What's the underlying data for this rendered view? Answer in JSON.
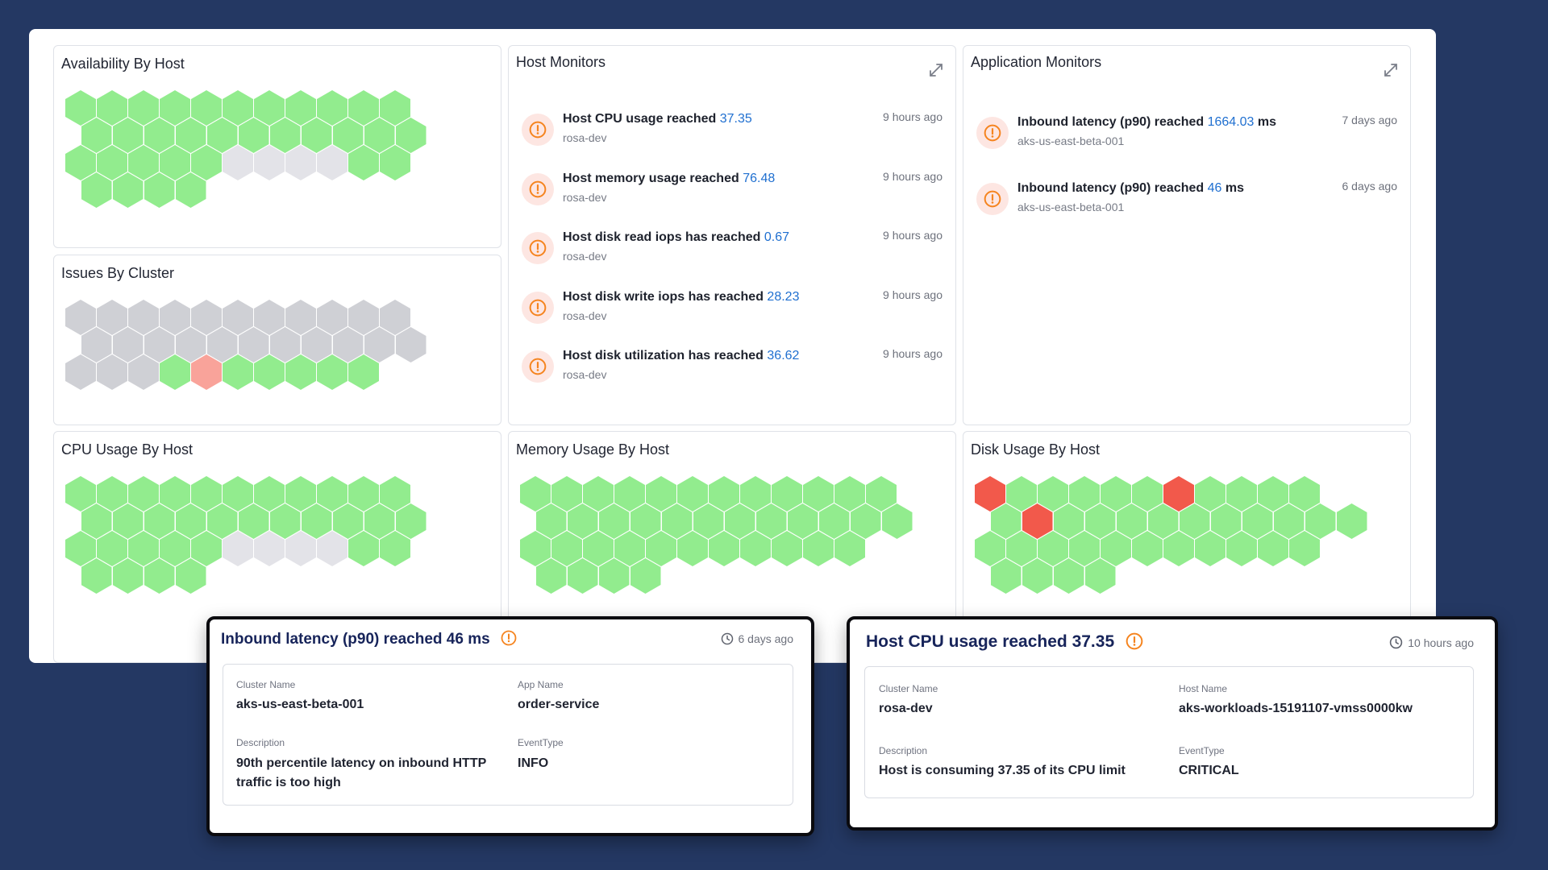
{
  "panels": {
    "availability": {
      "title": "Availability By Host"
    },
    "issues": {
      "title": "Issues By Cluster"
    },
    "cpu": {
      "title": "CPU Usage By Host"
    },
    "memory": {
      "title": "Memory Usage By Host"
    },
    "disk": {
      "title": "Disk Usage By Host"
    },
    "host_monitors": {
      "title": "Host Monitors",
      "items": [
        {
          "text": "Host CPU usage reached",
          "value": "37.35",
          "suffix": "",
          "source": "rosa-dev",
          "time": "9 hours ago"
        },
        {
          "text": "Host memory usage reached",
          "value": "76.48",
          "suffix": "",
          "source": "rosa-dev",
          "time": "9 hours ago"
        },
        {
          "text": "Host disk read iops has reached",
          "value": "0.67",
          "suffix": "",
          "source": "rosa-dev",
          "time": "9 hours ago"
        },
        {
          "text": "Host disk write iops has reached",
          "value": "28.23",
          "suffix": "",
          "source": "rosa-dev",
          "time": "9 hours ago"
        },
        {
          "text": "Host disk utilization has reached",
          "value": "36.62",
          "suffix": "",
          "source": "rosa-dev",
          "time": "9 hours ago"
        }
      ]
    },
    "app_monitors": {
      "title": "Application Monitors",
      "items": [
        {
          "text": "Inbound latency (p90) reached",
          "value": "1664.03",
          "suffix": "ms",
          "source": "aks-us-east-beta-001",
          "time": "7 days ago"
        },
        {
          "text": "Inbound latency (p90) reached",
          "value": "46",
          "suffix": "ms",
          "source": "aks-us-east-beta-001",
          "time": "6 days ago"
        }
      ]
    }
  },
  "hex_states": {
    "availability": [
      "g",
      "g",
      "g",
      "g",
      "g",
      "g",
      "g",
      "g",
      "g",
      "g",
      "g",
      "g",
      "g",
      "g",
      "g",
      "g",
      "g",
      "g",
      "g",
      "g",
      "g",
      "g",
      "g",
      "g",
      "g",
      "g",
      "g",
      "l",
      "l",
      "l",
      "l",
      "g",
      "g",
      "g",
      "g",
      "g",
      "g"
    ],
    "issues": [
      "a",
      "a",
      "a",
      "a",
      "a",
      "a",
      "a",
      "a",
      "a",
      "a",
      "a",
      "a",
      "a",
      "a",
      "a",
      "a",
      "a",
      "a",
      "a",
      "a",
      "a",
      "a",
      "a",
      "a",
      "a",
      "g",
      "s",
      "g",
      "g",
      "g",
      "g",
      "g"
    ],
    "cpu": [
      "g",
      "g",
      "g",
      "g",
      "g",
      "g",
      "g",
      "g",
      "g",
      "g",
      "g",
      "g",
      "g",
      "g",
      "g",
      "g",
      "g",
      "g",
      "g",
      "g",
      "g",
      "g",
      "g",
      "g",
      "g",
      "g",
      "g",
      "l",
      "l",
      "l",
      "l",
      "g",
      "g",
      "g",
      "g",
      "g",
      "g"
    ],
    "memory": [
      "g",
      "g",
      "g",
      "g",
      "g",
      "g",
      "g",
      "g",
      "g",
      "g",
      "g",
      "g",
      "g",
      "g",
      "g",
      "g",
      "g",
      "g",
      "g",
      "g",
      "g",
      "g",
      "g",
      "g",
      "g",
      "g",
      "g",
      "g",
      "g",
      "g",
      "g",
      "g",
      "g",
      "g",
      "g",
      "g",
      "g",
      "g",
      "g"
    ],
    "disk": [
      "r",
      "g",
      "g",
      "g",
      "g",
      "g",
      "r",
      "g",
      "g",
      "g",
      "g",
      "g",
      "r",
      "g",
      "g",
      "g",
      "g",
      "g",
      "g",
      "g",
      "g",
      "g",
      "g",
      "g",
      "g",
      "g",
      "g",
      "g",
      "g",
      "g",
      "g",
      "g",
      "g",
      "g",
      "g",
      "g",
      "g",
      "g"
    ]
  },
  "popup_left": {
    "title": "Inbound latency (p90) reached 46 ms",
    "time": "6 days ago",
    "fields": {
      "cluster_label": "Cluster Name",
      "cluster_value": "aks-us-east-beta-001",
      "app_label": "App Name",
      "app_value": "order-service",
      "desc_label": "Description",
      "desc_value": "90th percentile latency on inbound HTTP traffic is too high",
      "event_label": "EventType",
      "event_value": "INFO"
    }
  },
  "popup_right": {
    "title": "Host CPU usage reached 37.35",
    "time": "10 hours ago",
    "fields": {
      "cluster_label": "Cluster Name",
      "cluster_value": "rosa-dev",
      "host_label": "Host Name",
      "host_value": "aks-workloads-15191107-vmss0000kw",
      "desc_label": "Description",
      "desc_value": "Host is consuming 37.35 of its CPU limit",
      "event_label": "EventType",
      "event_value": "CRITICAL"
    }
  },
  "colors": {
    "background": "#243863",
    "healthy": "#92ec8e",
    "inactive": "#cfd0d5",
    "idle": "#e3e3e8",
    "warning": "#f9a39a",
    "critical": "#f2594b",
    "link": "#1f6fd0",
    "alert": "#f5841f",
    "popup_title": "#17245a"
  }
}
